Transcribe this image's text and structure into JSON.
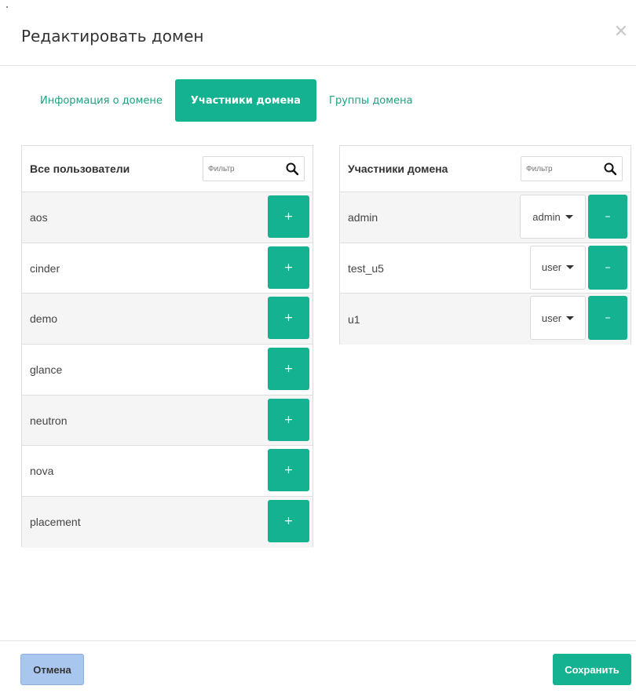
{
  "dialog": {
    "title": "Редактировать домен",
    "close_glyph": "✕"
  },
  "tabs": [
    {
      "label": "Информация о домене",
      "active": false
    },
    {
      "label": "Участники домена",
      "active": true
    },
    {
      "label": "Группы домена",
      "active": false
    }
  ],
  "all_users": {
    "title": "Все пользователи",
    "filter_placeholder": "Фильтр",
    "add_glyph": "+",
    "items": [
      "aos",
      "cinder",
      "demo",
      "glance",
      "neutron",
      "nova",
      "placement"
    ]
  },
  "members": {
    "title": "Участники домена",
    "filter_placeholder": "Фильтр",
    "remove_glyph": "–",
    "items": [
      {
        "name": "admin",
        "role": "admin"
      },
      {
        "name": "test_u5",
        "role": "user"
      },
      {
        "name": "u1",
        "role": "user"
      }
    ]
  },
  "footer": {
    "cancel_label": "Отмена",
    "save_label": "Сохранить"
  },
  "colors": {
    "accent": "#14b291",
    "cancel_bg": "#a9c6ee"
  },
  "icons": {
    "search": "search-icon",
    "close": "close-icon",
    "caret": "caret-down-icon"
  }
}
